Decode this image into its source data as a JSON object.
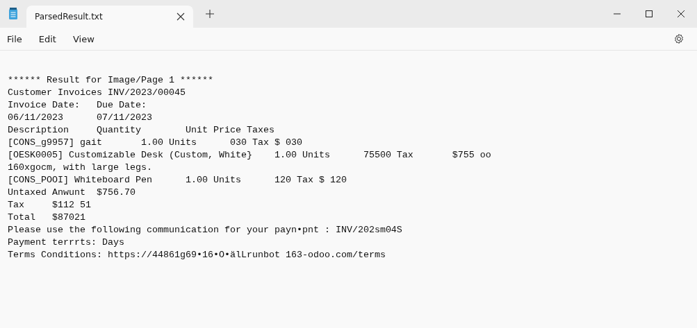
{
  "window": {
    "tabs": [
      {
        "title": "ParsedResult.txt",
        "selected": true
      }
    ]
  },
  "menu": [
    "File",
    "Edit",
    "View"
  ],
  "lines": [
    "****** Result for Image/Page 1 ******",
    "Customer Invoices INV/2023/00045",
    "Invoice Date:   Due Date:",
    "06/11/2023      07/11/2023",
    "Description     Quantity        Unit Price Taxes",
    "[CONS_g9957] gait       1.00 Units      030 Tax $ 030",
    "[OESK0005] Customizable Desk (Custom, White}    1.00 Units      75500 Tax       $755 oo",
    "160xgocm, with large legs.",
    "[CONS_POOI] Whiteboard Pen      1.00 Units      120 Tax $ 120",
    "Untaxed Anwunt  $756.70",
    "Tax     $112 51",
    "Total   $87021",
    "Please use the following communication for your payn•pnt : INV/202sm04S",
    "Payment terrrts: Days",
    "Terms Conditions: https://44861g69•16•O•älLrunbot 163-odoo.com/terms"
  ]
}
